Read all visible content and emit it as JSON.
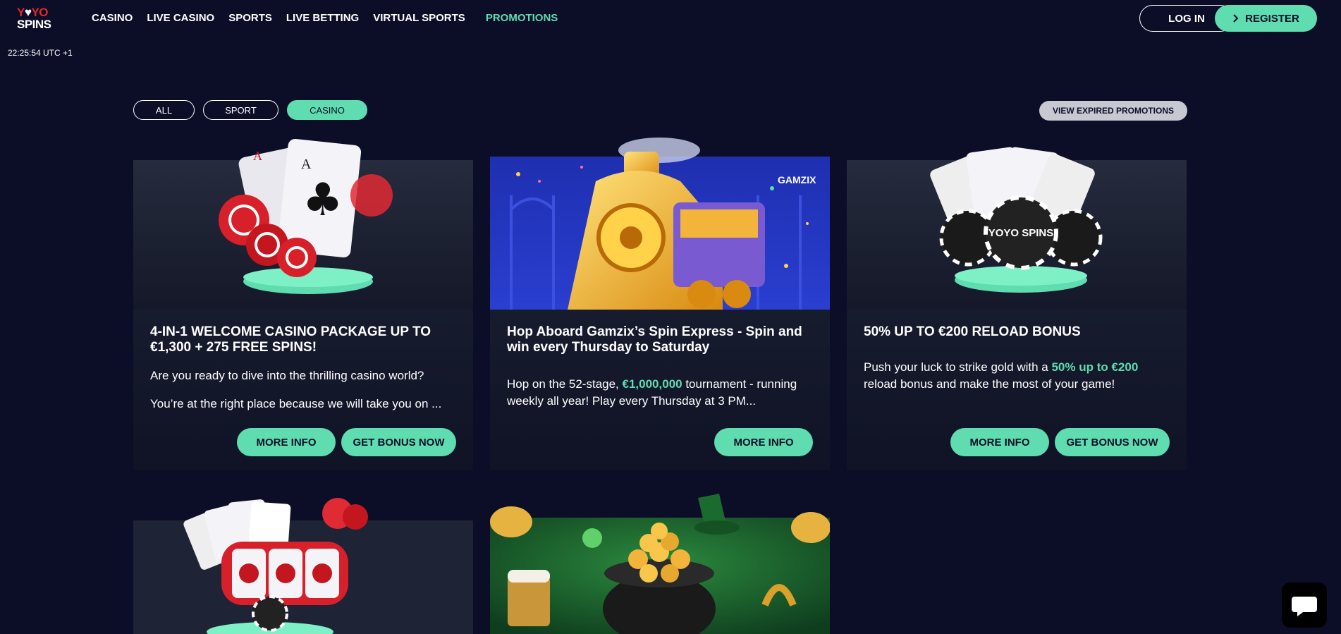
{
  "brand": {
    "line1_a": "Y",
    "line1_o": "♥",
    "line1_b": "YO",
    "line2": "SPINS"
  },
  "nav": {
    "items": [
      "CASINO",
      "LIVE CASINO",
      "SPORTS",
      "LIVE BETTING",
      "VIRTUAL SPORTS"
    ],
    "promotions": "PROMOTIONS"
  },
  "header": {
    "login": "LOG IN",
    "register": "REGISTER",
    "register_icon": "chevron-right-icon"
  },
  "clock": "22:25:54 UTC +1",
  "filters": {
    "all": "ALL",
    "sport": "SPORT",
    "casino": "CASINO",
    "active": "CASINO"
  },
  "expired": "VIEW EXPIRED PROMOTIONS",
  "promos": [
    {
      "title": "4-IN-1 WELCOME CASINO PACKAGE UP TO €1,300 + 275 FREE SPINS!",
      "text1": "Are you ready to dive into the thrilling casino world?",
      "text2": "You’re at the right place because we will take you on ...",
      "more": "MORE INFO",
      "bonus": "GET BONUS NOW"
    },
    {
      "title": "Hop Aboard Gamzix’s Spin Express - Spin and win every Thursday to Saturday",
      "text_a": "Hop on the 52-stage, ",
      "text_hl": "€1,000,000",
      "text_b": " tournament - running weekly all year! Play every Thursday at 3 PM...",
      "badge": "GAMZIX",
      "more": "MORE INFO"
    },
    {
      "title": "50% UP TO €200 RELOAD BONUS",
      "text_a": "Push your luck to strike gold with a ",
      "text_hl": "50% up to €200",
      "text_b": " reload bonus and make the most of your game!",
      "more": "MORE INFO",
      "bonus": "GET BONUS NOW"
    }
  ],
  "chips_text": "YOYO SPINS",
  "colors": {
    "accent": "#5fdcb0",
    "background": "#0b0e26",
    "brand_red": "#e3252d"
  }
}
